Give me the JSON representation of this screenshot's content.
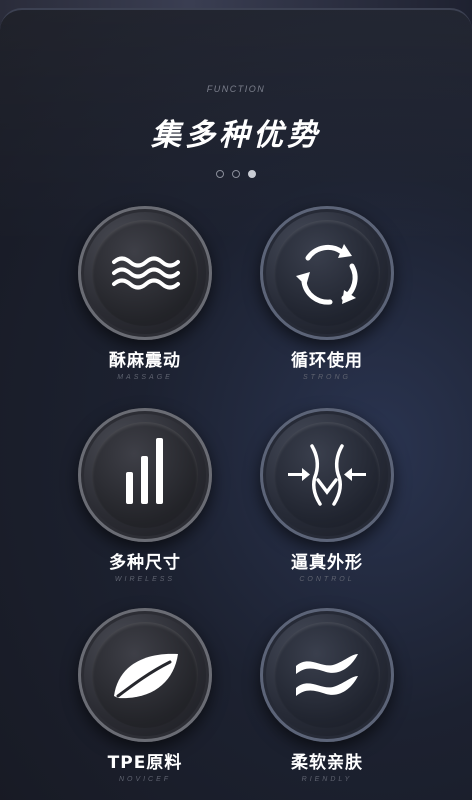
{
  "header": {
    "kicker": "FUNCTION",
    "title": "集多种优势"
  },
  "pagination": {
    "count": 3,
    "active_index": 2
  },
  "features": [
    {
      "label": "酥麻震动",
      "subtitle": "MASSAGE",
      "icon": "waves-icon"
    },
    {
      "label": "循环使用",
      "subtitle": "STRONG",
      "icon": "recycle-icon"
    },
    {
      "label": "多种尺寸",
      "subtitle": "WIRELESS",
      "icon": "size-bars-icon"
    },
    {
      "label": "逼真外形",
      "subtitle": "CONTROL",
      "icon": "body-shape-icon"
    },
    {
      "label": "TPE原料",
      "subtitle": "NOVICEF",
      "icon": "leaf-icon"
    },
    {
      "label": "柔软亲肤",
      "subtitle": "RIENDLY",
      "icon": "soft-wave-icon"
    }
  ]
}
